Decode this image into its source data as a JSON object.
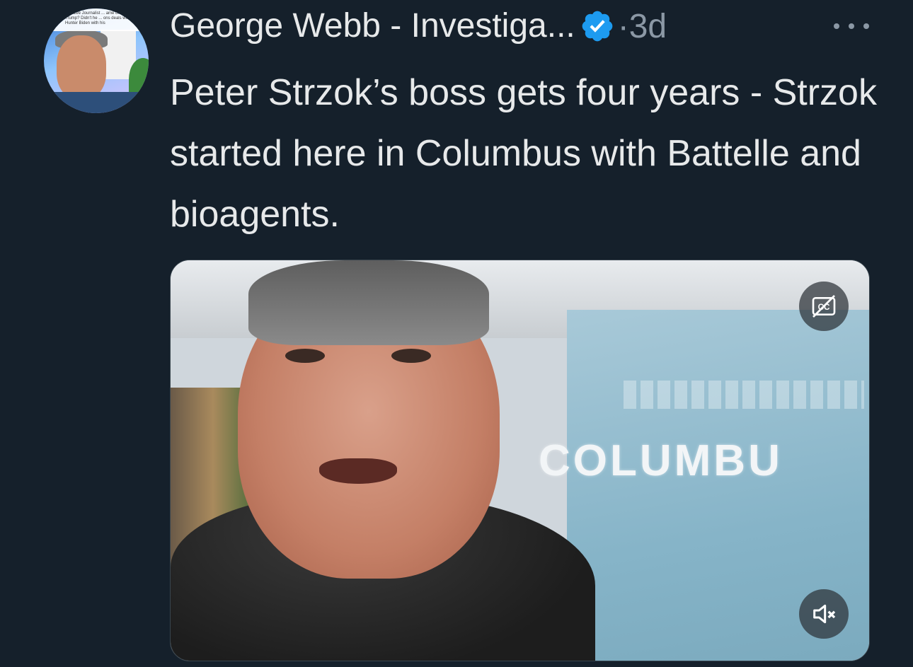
{
  "tweet": {
    "author_name": "George Webb - Investiga...",
    "separator": "·",
    "timestamp": "3d",
    "text": "Peter Strzok’s boss gets four years - Strzok started here in Columbus with Battelle and bioagents.",
    "verified": true
  },
  "avatar": {
    "banner_text": "stigative Journalist ... ame of Yu to Trump? Didn't he ... ons deals with Hunter Biden with his"
  },
  "media": {
    "type": "video",
    "sign_text": "COLUMBU",
    "captions_icon": "closed-captions-off-icon",
    "mute_icon": "muted-speaker-icon"
  },
  "colors": {
    "background": "#15202b",
    "text_primary": "#e7e9ea",
    "text_secondary": "#8b98a5",
    "verified_badge": "#1d9bf0"
  }
}
